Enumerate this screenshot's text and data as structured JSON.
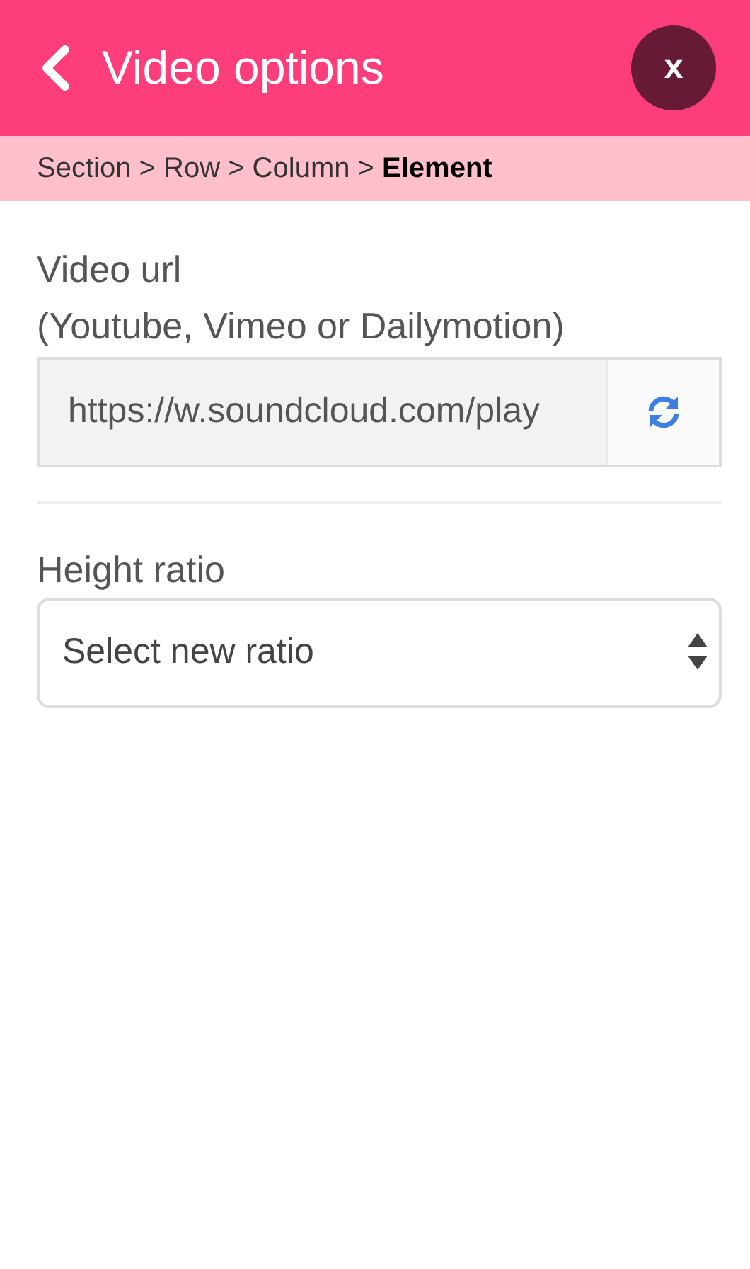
{
  "header": {
    "title": "Video options",
    "close_label": "x"
  },
  "breadcrumb": "Section > Row > Column > **Element**",
  "fields": [
    {
      "kind": "url",
      "label": "Video url",
      "hint": "(Youtube, Vimeo or Dailymotion)",
      "value": "https://w.soundcloud.com/play",
      "disabled": true
    },
    {
      "kind": "select",
      "label": "Height ratio",
      "value": "Select new ratio"
    }
  ]
}
